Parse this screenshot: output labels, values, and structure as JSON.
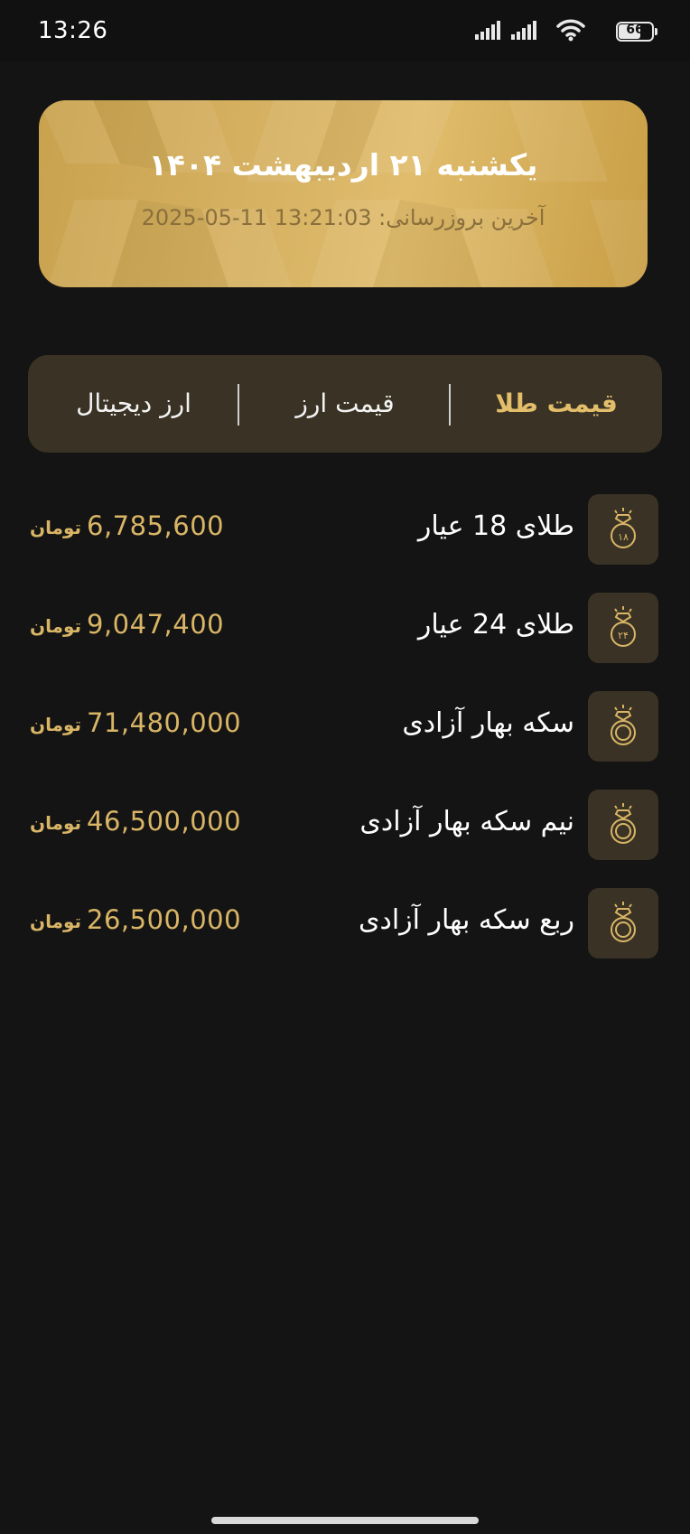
{
  "status_bar": {
    "time": "13:26",
    "battery_level": "66",
    "icons": [
      "signal-icon",
      "signal-icon",
      "wifi-icon",
      "battery-icon"
    ]
  },
  "header": {
    "date_title": "یکشنبه ۲۱ اردیبهشت ۱۴۰۴",
    "last_update_label": "آخرین بروزرسانی:",
    "last_update_value": "2025-05-11 13:21:03"
  },
  "tabs": [
    {
      "label": "قیمت طلا",
      "active": true
    },
    {
      "label": "قیمت ارز",
      "active": false
    },
    {
      "label": "ارز دیجیتال",
      "active": false
    }
  ],
  "items": [
    {
      "name": "طلای 18 عیار",
      "price": "6,785,600",
      "currency": "تومان",
      "icon": "gold-ring-18-icon",
      "badge": "۱۸"
    },
    {
      "name": "طلای 24 عیار",
      "price": "9,047,400",
      "currency": "تومان",
      "icon": "gold-ring-24-icon",
      "badge": "۲۴"
    },
    {
      "name": "سکه بهار آزادی",
      "price": "71,480,000",
      "currency": "تومان",
      "icon": "diamond-ring-icon",
      "badge": ""
    },
    {
      "name": "نیم سکه بهار آزادی",
      "price": "46,500,000",
      "currency": "تومان",
      "icon": "diamond-ring-icon",
      "badge": ""
    },
    {
      "name": "ربع سکه بهار آزادی",
      "price": "26,500,000",
      "currency": "تومان",
      "icon": "diamond-ring-icon",
      "badge": ""
    }
  ],
  "colors": {
    "background": "#141414",
    "accent_gold": "#d9b566",
    "card_dark": "#3a3325"
  }
}
